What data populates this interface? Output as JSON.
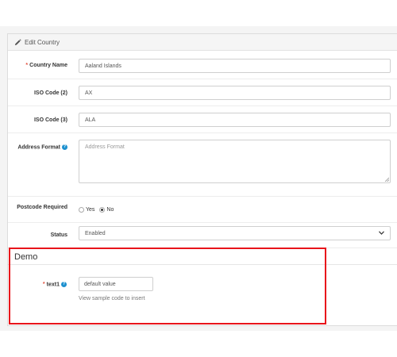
{
  "panel": {
    "heading": "Edit Country",
    "heading_icon": "pencil-icon"
  },
  "fields": {
    "country_name": {
      "required_mark": "*",
      "label": "Country Name",
      "value": "Aaland Islands"
    },
    "iso2": {
      "label": "ISO Code (2)",
      "value": "AX"
    },
    "iso3": {
      "label": "ISO Code (3)",
      "value": "ALA"
    },
    "address_format": {
      "label": "Address Format",
      "help_icon": "question-circle-icon",
      "placeholder": "Address Format"
    },
    "postcode_required": {
      "label": "Postcode Required",
      "options": [
        "Yes",
        "No"
      ],
      "selected": "No"
    },
    "status": {
      "label": "Status",
      "value": "Enabled"
    }
  },
  "demo": {
    "title": "Demo",
    "text1": {
      "required_mark": "*",
      "label": "text1",
      "help_icon": "question-circle-icon",
      "value": "default value",
      "help_text": "View sample code to insert"
    }
  },
  "colors": {
    "required": "#e3503e",
    "help": "#1e91cf",
    "highlight": "#e8141b"
  }
}
